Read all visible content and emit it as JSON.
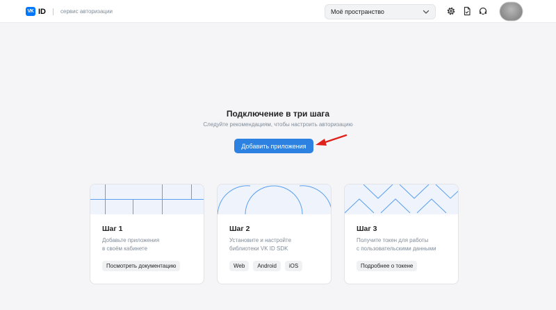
{
  "header": {
    "logo_text": "VK",
    "logo_id": "ID",
    "subtitle": "сервис авторизации",
    "workspace": "Моё пространство"
  },
  "hero": {
    "title": "Подключение в три шага",
    "subtitle": "Следуйте рекомендациям, чтобы настроить авторизацию",
    "button": "Добавить приложения"
  },
  "steps": [
    {
      "title": "Шаг 1",
      "desc_line1": "Добавьте приложения",
      "desc_line2": "в своём кабинете",
      "chips": [
        "Посмотреть документацию"
      ]
    },
    {
      "title": "Шаг 2",
      "desc_line1": "Установите и настройте",
      "desc_line2": "библиотеки VK ID SDK",
      "chips": [
        "Web",
        "Android",
        "iOS"
      ]
    },
    {
      "title": "Шаг 3",
      "desc_line1": "Получите токен для работы",
      "desc_line2": "с пользовательскими данными",
      "chips": [
        "Подробнее о токене"
      ]
    }
  ],
  "colors": {
    "accent": "#2d81e0",
    "brand": "#0077ff",
    "card_art_bg": "#eef3fc",
    "card_art_line": "#5b9ff0",
    "annotation_arrow": "#e0201b"
  },
  "icons": {
    "settings": "gear-icon",
    "docs": "document-icon",
    "support": "headset-icon",
    "workspace_dropdown": "chevron-down-icon"
  }
}
